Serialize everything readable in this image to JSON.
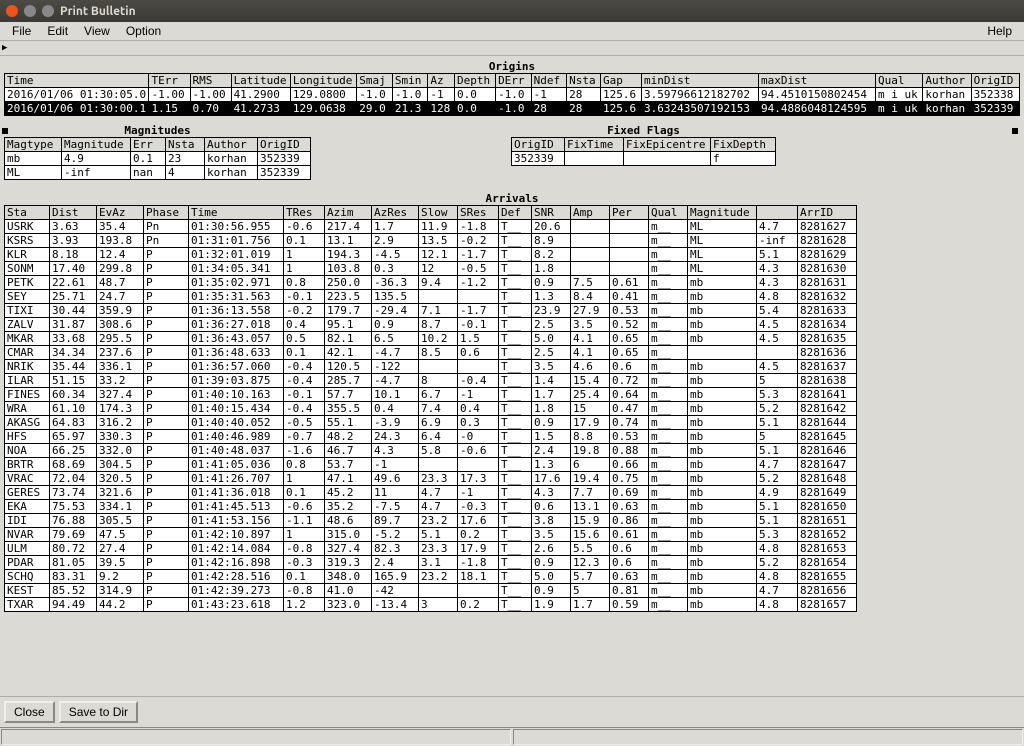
{
  "window": {
    "title": "Print Bulletin"
  },
  "menu": {
    "file": "File",
    "edit": "Edit",
    "view": "View",
    "option": "Option",
    "help": "Help"
  },
  "origins": {
    "title": "Origins",
    "headers": [
      "Time",
      "TErr",
      "RMS",
      "Latitude",
      "Longitude",
      "Smaj",
      "Smin",
      "Az",
      "Depth",
      "DErr",
      "Ndef",
      "Nsta",
      "Gap",
      "minDist",
      "maxDist",
      "Qual",
      "Author",
      "OrigID"
    ],
    "rows": [
      [
        "2016/01/06 01:30:05.0",
        "-1.00",
        "-1.00",
        "41.2900",
        "129.0800",
        "-1.0",
        "-1.0",
        "-1",
        "0.0",
        "-1.0",
        "-1",
        "28",
        "125.6",
        "3.59796612182702",
        "94.4510150802454",
        "m i uk",
        "korhan",
        "352338"
      ],
      [
        "2016/01/06 01:30:00.1",
        "1.15",
        "0.70",
        "41.2733",
        "129.0638",
        "29.0",
        "21.3",
        "128",
        "0.0",
        "-1.0",
        "28",
        "28",
        "125.6",
        "3.63243507192153",
        "94.4886048124595",
        "m i uk",
        "korhan",
        "352339"
      ]
    ],
    "selected": 1
  },
  "magnitudes": {
    "title": "Magnitudes",
    "headers": [
      "Magtype",
      "Magnitude",
      "Err",
      "Nsta",
      "Author",
      "OrigID"
    ],
    "rows": [
      [
        "mb",
        "4.9",
        "0.1",
        "23",
        "korhan",
        "352339"
      ],
      [
        "ML",
        "-inf",
        "nan",
        "4",
        "korhan",
        "352339"
      ]
    ]
  },
  "fixedflags": {
    "title": "Fixed Flags",
    "headers": [
      "OrigID",
      "FixTime",
      "FixEpicentre",
      "FixDepth"
    ],
    "rows": [
      [
        "352339",
        "",
        "",
        "f"
      ]
    ]
  },
  "arrivals": {
    "title": "Arrivals",
    "headers": [
      "Sta",
      "Dist",
      "EvAz",
      "Phase",
      "Time",
      "TRes",
      "Azim",
      "AzRes",
      "Slow",
      "SRes",
      "Def",
      "SNR",
      "Amp",
      "Per",
      "Qual",
      "Magnitude",
      "",
      "ArrID"
    ],
    "rows": [
      [
        "USRK",
        "3.63",
        "35.4",
        "Pn",
        "01:30:56.955",
        "-0.6",
        "217.4",
        "1.7",
        "11.9",
        "-1.8",
        "T__",
        "20.6",
        "",
        "",
        "m__",
        "ML",
        "4.7",
        "8281627"
      ],
      [
        "KSRS",
        "3.93",
        "193.8",
        "Pn",
        "01:31:01.756",
        "0.1",
        "13.1",
        "2.9",
        "13.5",
        "-0.2",
        "T__",
        "8.9",
        "",
        "",
        "m__",
        "ML",
        "-inf",
        "8281628"
      ],
      [
        "KLR",
        "8.18",
        "12.4",
        "P",
        "01:32:01.019",
        "1",
        "194.3",
        "-4.5",
        "12.1",
        "-1.7",
        "T__",
        "8.2",
        "",
        "",
        "m__",
        "ML",
        "5.1",
        "8281629"
      ],
      [
        "SONM",
        "17.40",
        "299.8",
        "P",
        "01:34:05.341",
        "1",
        "103.8",
        "0.3",
        "12",
        "-0.5",
        "T__",
        "1.8",
        "",
        "",
        "m__",
        "ML",
        "4.3",
        "8281630"
      ],
      [
        "PETK",
        "22.61",
        "48.7",
        "P",
        "01:35:02.971",
        "0.8",
        "250.0",
        "-36.3",
        "9.4",
        "-1.2",
        "T__",
        "0.9",
        "7.5",
        "0.61",
        "m__",
        "mb",
        "4.3",
        "8281631"
      ],
      [
        "SEY",
        "25.71",
        "24.7",
        "P",
        "01:35:31.563",
        "-0.1",
        "223.5",
        "135.5",
        "",
        "",
        "T__",
        "1.3",
        "8.4",
        "0.41",
        "m__",
        "mb",
        "4.8",
        "8281632"
      ],
      [
        "TIXI",
        "30.44",
        "359.9",
        "P",
        "01:36:13.558",
        "-0.2",
        "179.7",
        "-29.4",
        "7.1",
        "-1.7",
        "T__",
        "23.9",
        "27.9",
        "0.53",
        "m__",
        "mb",
        "5.4",
        "8281633"
      ],
      [
        "ZALV",
        "31.87",
        "308.6",
        "P",
        "01:36:27.018",
        "0.4",
        "95.1",
        "0.9",
        "8.7",
        "-0.1",
        "T__",
        "2.5",
        "3.5",
        "0.52",
        "m__",
        "mb",
        "4.5",
        "8281634"
      ],
      [
        "MKAR",
        "33.68",
        "295.5",
        "P",
        "01:36:43.057",
        "0.5",
        "82.1",
        "6.5",
        "10.2",
        "1.5",
        "T__",
        "5.0",
        "4.1",
        "0.65",
        "m__",
        "mb",
        "4.5",
        "8281635"
      ],
      [
        "CMAR",
        "34.34",
        "237.6",
        "P",
        "01:36:48.633",
        "0.1",
        "42.1",
        "-4.7",
        "8.5",
        "0.6",
        "T__",
        "2.5",
        "4.1",
        "0.65",
        "m__",
        "",
        "",
        "8281636"
      ],
      [
        "NRIK",
        "35.44",
        "336.1",
        "P",
        "01:36:57.060",
        "-0.4",
        "120.5",
        "-122",
        "",
        "",
        "T__",
        "3.5",
        "4.6",
        "0.6",
        "m__",
        "mb",
        "4.5",
        "8281637"
      ],
      [
        "ILAR",
        "51.15",
        "33.2",
        "P",
        "01:39:03.875",
        "-0.4",
        "285.7",
        "-4.7",
        "8",
        "-0.4",
        "T__",
        "1.4",
        "15.4",
        "0.72",
        "m__",
        "mb",
        "5",
        "8281638"
      ],
      [
        "FINES",
        "60.34",
        "327.4",
        "P",
        "01:40:10.163",
        "-0.1",
        "57.7",
        "10.1",
        "6.7",
        "-1",
        "T__",
        "1.7",
        "25.4",
        "0.64",
        "m__",
        "mb",
        "5.3",
        "8281641"
      ],
      [
        "WRA",
        "61.10",
        "174.3",
        "P",
        "01:40:15.434",
        "-0.4",
        "355.5",
        "0.4",
        "7.4",
        "0.4",
        "T__",
        "1.8",
        "15",
        "0.47",
        "m__",
        "mb",
        "5.2",
        "8281642"
      ],
      [
        "AKASG",
        "64.83",
        "316.2",
        "P",
        "01:40:40.052",
        "-0.5",
        "55.1",
        "-3.9",
        "6.9",
        "0.3",
        "T__",
        "0.9",
        "17.9",
        "0.74",
        "m__",
        "mb",
        "5.1",
        "8281644"
      ],
      [
        "HFS",
        "65.97",
        "330.3",
        "P",
        "01:40:46.989",
        "-0.7",
        "48.2",
        "24.3",
        "6.4",
        "-0",
        "T__",
        "1.5",
        "8.8",
        "0.53",
        "m__",
        "mb",
        "5",
        "8281645"
      ],
      [
        "NOA",
        "66.25",
        "332.0",
        "P",
        "01:40:48.037",
        "-1.6",
        "46.7",
        "4.3",
        "5.8",
        "-0.6",
        "T__",
        "2.4",
        "19.8",
        "0.88",
        "m__",
        "mb",
        "5.1",
        "8281646"
      ],
      [
        "BRTR",
        "68.69",
        "304.5",
        "P",
        "01:41:05.036",
        "0.8",
        "53.7",
        "-1",
        "",
        "",
        "T__",
        "1.3",
        "6",
        "0.66",
        "m__",
        "mb",
        "4.7",
        "8281647"
      ],
      [
        "VRAC",
        "72.04",
        "320.5",
        "P",
        "01:41:26.707",
        "1",
        "47.1",
        "49.6",
        "23.3",
        "17.3",
        "T__",
        "17.6",
        "19.4",
        "0.75",
        "m__",
        "mb",
        "5.2",
        "8281648"
      ],
      [
        "GERES",
        "73.74",
        "321.6",
        "P",
        "01:41:36.018",
        "0.1",
        "45.2",
        "11",
        "4.7",
        "-1",
        "T__",
        "4.3",
        "7.7",
        "0.69",
        "m__",
        "mb",
        "4.9",
        "8281649"
      ],
      [
        "EKA",
        "75.53",
        "334.1",
        "P",
        "01:41:45.513",
        "-0.6",
        "35.2",
        "-7.5",
        "4.7",
        "-0.3",
        "T__",
        "0.6",
        "13.1",
        "0.63",
        "m__",
        "mb",
        "5.1",
        "8281650"
      ],
      [
        "IDI",
        "76.88",
        "305.5",
        "P",
        "01:41:53.156",
        "-1.1",
        "48.6",
        "89.7",
        "23.2",
        "17.6",
        "T__",
        "3.8",
        "15.9",
        "0.86",
        "m__",
        "mb",
        "5.1",
        "8281651"
      ],
      [
        "NVAR",
        "79.69",
        "47.5",
        "P",
        "01:42:10.897",
        "1",
        "315.0",
        "-5.2",
        "5.1",
        "0.2",
        "T__",
        "3.5",
        "15.6",
        "0.61",
        "m__",
        "mb",
        "5.3",
        "8281652"
      ],
      [
        "ULM",
        "80.72",
        "27.4",
        "P",
        "01:42:14.084",
        "-0.8",
        "327.4",
        "82.3",
        "23.3",
        "17.9",
        "T__",
        "2.6",
        "5.5",
        "0.6",
        "m__",
        "mb",
        "4.8",
        "8281653"
      ],
      [
        "PDAR",
        "81.05",
        "39.5",
        "P",
        "01:42:16.898",
        "-0.3",
        "319.3",
        "2.4",
        "3.1",
        "-1.8",
        "T__",
        "0.9",
        "12.3",
        "0.6",
        "m__",
        "mb",
        "5.2",
        "8281654"
      ],
      [
        "SCHQ",
        "83.31",
        "9.2",
        "P",
        "01:42:28.516",
        "0.1",
        "348.0",
        "165.9",
        "23.2",
        "18.1",
        "T__",
        "5.0",
        "5.7",
        "0.63",
        "m__",
        "mb",
        "4.8",
        "8281655"
      ],
      [
        "KEST",
        "85.52",
        "314.9",
        "P",
        "01:42:39.273",
        "-0.8",
        "41.0",
        "-42",
        "",
        "",
        "T__",
        "0.9",
        "5",
        "0.81",
        "m__",
        "mb",
        "4.7",
        "8281656"
      ],
      [
        "TXAR",
        "94.49",
        "44.2",
        "P",
        "01:43:23.618",
        "1.2",
        "323.0",
        "-13.4",
        "3",
        "0.2",
        "T__",
        "1.9",
        "1.7",
        "0.59",
        "m__",
        "mb",
        "4.8",
        "8281657"
      ]
    ]
  },
  "footer": {
    "close": "Close",
    "save": "Save to Dir"
  }
}
